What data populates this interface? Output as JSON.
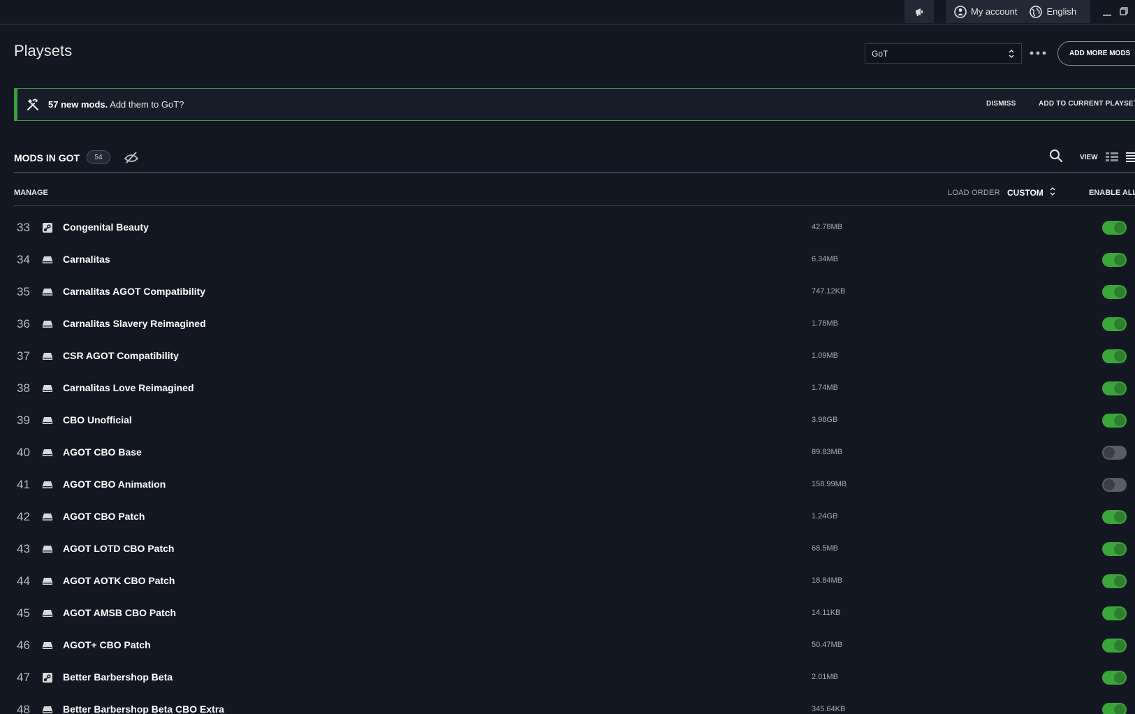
{
  "topbar": {
    "account_label": "My account",
    "language_label": "English"
  },
  "header": {
    "title": "Playsets",
    "playset_selected": "GoT",
    "add_more_label": "ADD MORE MODS"
  },
  "banner": {
    "count_text": "57 new mods.",
    "message": "Add them to GoT?",
    "dismiss_label": "DISMISS",
    "add_label": "ADD TO CURRENT PLAYSET"
  },
  "mods_section": {
    "title": "MODS IN GOT",
    "count": "54",
    "view_label": "VIEW"
  },
  "manage": {
    "label": "MANAGE",
    "load_order_label": "LOAD ORDER",
    "load_order_value": "CUSTOM",
    "enable_all_label": "ENABLE ALL"
  },
  "mods": [
    {
      "num": "33",
      "source": "steam",
      "name": "Congenital Beauty",
      "size": "42.78MB",
      "enabled": true
    },
    {
      "num": "34",
      "source": "local",
      "name": "Carnalitas",
      "size": "6.34MB",
      "enabled": true
    },
    {
      "num": "35",
      "source": "local",
      "name": "Carnalitas AGOT Compatibility",
      "size": "747.12KB",
      "enabled": true
    },
    {
      "num": "36",
      "source": "local",
      "name": "Carnalitas Slavery Reimagined",
      "size": "1.78MB",
      "enabled": true
    },
    {
      "num": "37",
      "source": "local",
      "name": "CSR AGOT Compatibility",
      "size": "1.09MB",
      "enabled": true
    },
    {
      "num": "38",
      "source": "local",
      "name": "Carnalitas Love Reimagined",
      "size": "1.74MB",
      "enabled": true
    },
    {
      "num": "39",
      "source": "local",
      "name": "CBO Unofficial",
      "size": "3.98GB",
      "enabled": true
    },
    {
      "num": "40",
      "source": "local",
      "name": "AGOT CBO Base",
      "size": "89.83MB",
      "enabled": false
    },
    {
      "num": "41",
      "source": "local",
      "name": "AGOT CBO Animation",
      "size": "158.99MB",
      "enabled": false
    },
    {
      "num": "42",
      "source": "local",
      "name": "AGOT CBO Patch",
      "size": "1.24GB",
      "enabled": true
    },
    {
      "num": "43",
      "source": "local",
      "name": "AGOT LOTD CBO Patch",
      "size": "68.5MB",
      "enabled": true
    },
    {
      "num": "44",
      "source": "local",
      "name": "AGOT AOTK CBO Patch",
      "size": "18.84MB",
      "enabled": true
    },
    {
      "num": "45",
      "source": "local",
      "name": "AGOT AMSB CBO Patch",
      "size": "14.11KB",
      "enabled": true
    },
    {
      "num": "46",
      "source": "local",
      "name": "AGOT+ CBO Patch",
      "size": "50.47MB",
      "enabled": true
    },
    {
      "num": "47",
      "source": "steam",
      "name": "Better Barbershop Beta",
      "size": "2.01MB",
      "enabled": true
    },
    {
      "num": "48",
      "source": "local",
      "name": "Better Barbershop Beta CBO Extra",
      "size": "345.64KB",
      "enabled": true
    }
  ],
  "colors": {
    "background": "#131722",
    "accent_green": "#3aa63a",
    "banner_border": "#3a9e3a",
    "toggle_off": "#5a5d66"
  }
}
